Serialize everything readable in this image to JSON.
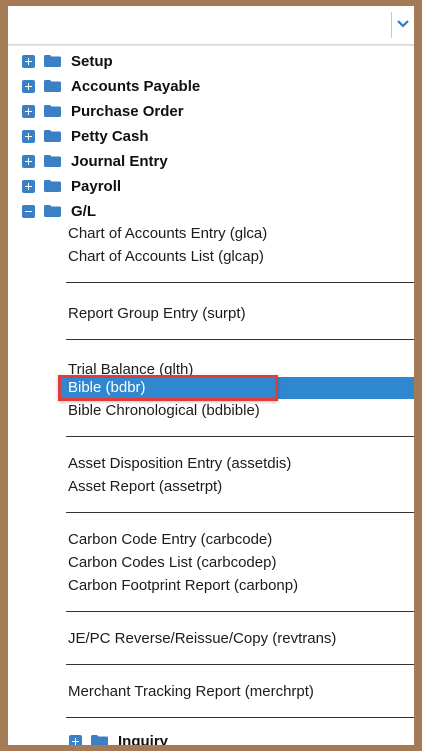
{
  "dropdown": {
    "icon": "chevron-down-icon"
  },
  "tree": {
    "nodes": [
      {
        "label": "Setup",
        "expander": "plus"
      },
      {
        "label": "Accounts Payable",
        "expander": "plus"
      },
      {
        "label": "Purchase Order",
        "expander": "plus"
      },
      {
        "label": "Petty Cash",
        "expander": "plus"
      },
      {
        "label": "Journal Entry",
        "expander": "plus"
      },
      {
        "label": "Payroll",
        "expander": "plus"
      },
      {
        "label": "G/L",
        "expander": "minus"
      }
    ],
    "gl_items": [
      "Chart of Accounts Entry (glca)",
      "Chart of Accounts List (glcap)",
      "Report Group Entry (surpt)",
      "Trial Balance (glth)",
      "Bible (bdbr)",
      "Bible Chronological (bdbible)",
      "Asset Disposition Entry (assetdis)",
      "Asset Report (assetrpt)",
      "Carbon Code Entry (carbcode)",
      "Carbon Codes List (carbcodep)",
      "Carbon Footprint Report (carbonp)",
      "JE/PC Reverse/Reissue/Copy (revtrans)",
      "Merchant Tracking Report (merchrpt)"
    ],
    "inquiry": {
      "label": "Inquiry",
      "expander": "plus"
    }
  },
  "colors": {
    "frame": "#a47a57",
    "expander": "#3b7fc4",
    "selection": "#2f87d0",
    "highlight_box": "#e23b3b"
  }
}
